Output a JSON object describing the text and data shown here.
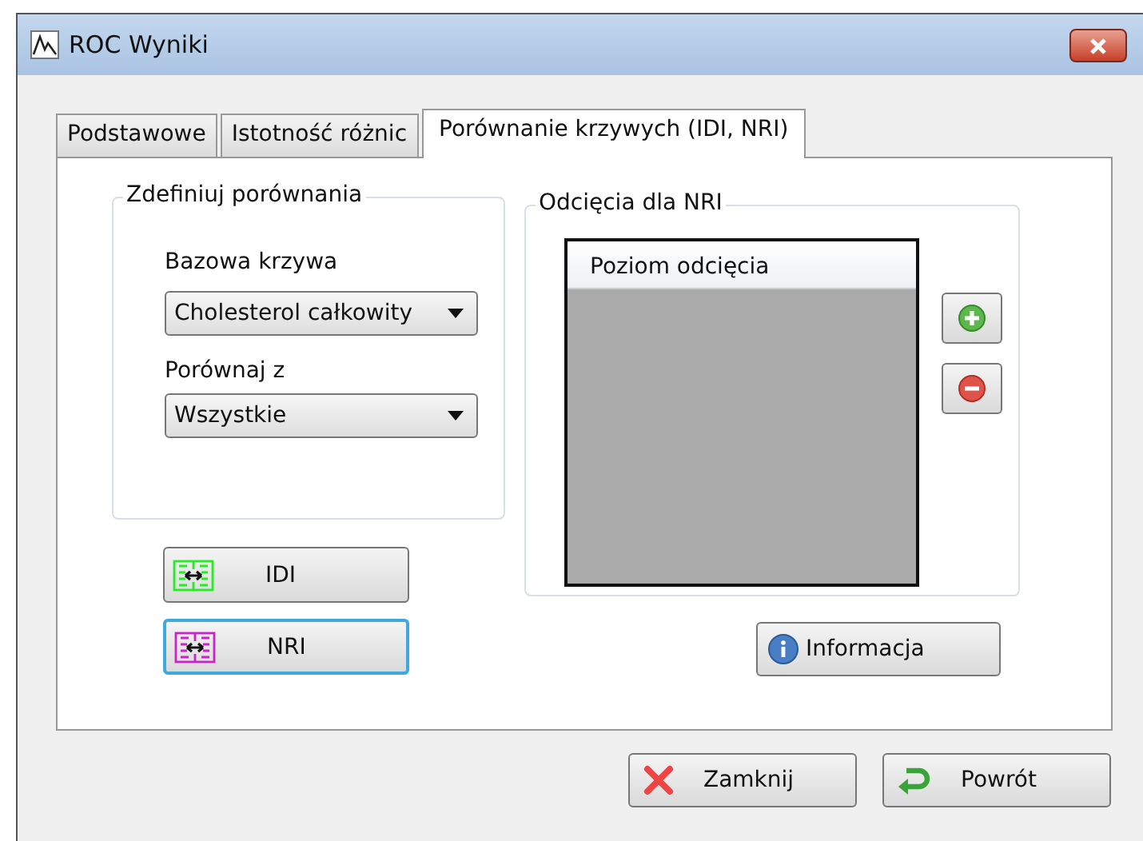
{
  "window": {
    "title": "ROC Wyniki"
  },
  "tabs": [
    {
      "label": "Podstawowe",
      "selected": false
    },
    {
      "label": "Istotność różnic",
      "selected": false
    },
    {
      "label": "Porównanie krzywych (IDI, NRI)",
      "selected": true
    }
  ],
  "define_group": {
    "title": "Zdefiniuj porównania",
    "base_label": "Bazowa krzywa",
    "base_value": "Cholesterol całkowity",
    "compare_label": "Porównaj z",
    "compare_value": "Wszystkie"
  },
  "method_buttons": [
    {
      "label": "IDI",
      "color": "#22ee22",
      "focused": false
    },
    {
      "label": "NRI",
      "color": "#cc22cc",
      "focused": true
    }
  ],
  "cutoff_group": {
    "title": "Odcięcia dla NRI",
    "column": "Poziom odcięcia"
  },
  "info_button": "Informacja",
  "footer_buttons": [
    {
      "kind": "close",
      "label": "Zamknij"
    },
    {
      "kind": "back",
      "label": "Powrót"
    }
  ]
}
